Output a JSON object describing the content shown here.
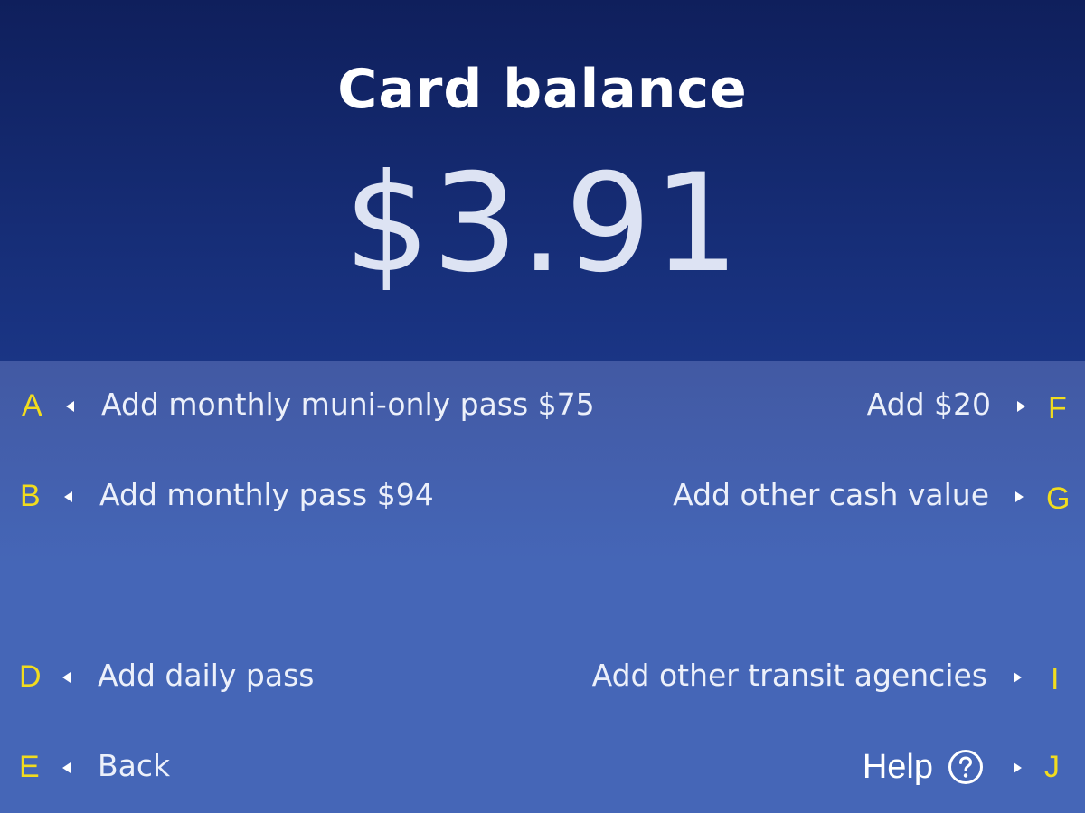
{
  "header": {
    "title": "Card balance",
    "balance": "$3.91"
  },
  "options": {
    "A": {
      "key": "A",
      "label": "Add monthly muni-only pass $75"
    },
    "B": {
      "key": "B",
      "label": "Add monthly pass $94"
    },
    "D": {
      "key": "D",
      "label": "Add daily pass"
    },
    "E": {
      "key": "E",
      "label": "Back"
    },
    "F": {
      "key": "F",
      "label": "Add $20"
    },
    "G": {
      "key": "G",
      "label": "Add other cash value"
    },
    "I": {
      "key": "I",
      "label": "Add other transit agencies"
    },
    "J": {
      "key": "J",
      "label": "Help",
      "icon": "question-circle-icon"
    }
  },
  "colors": {
    "header_top": "#0f1f5c",
    "header_bottom": "#1a3585",
    "panel": "#4566b7",
    "key_letter": "#f1dc1e",
    "text": "#ecf0fa"
  }
}
